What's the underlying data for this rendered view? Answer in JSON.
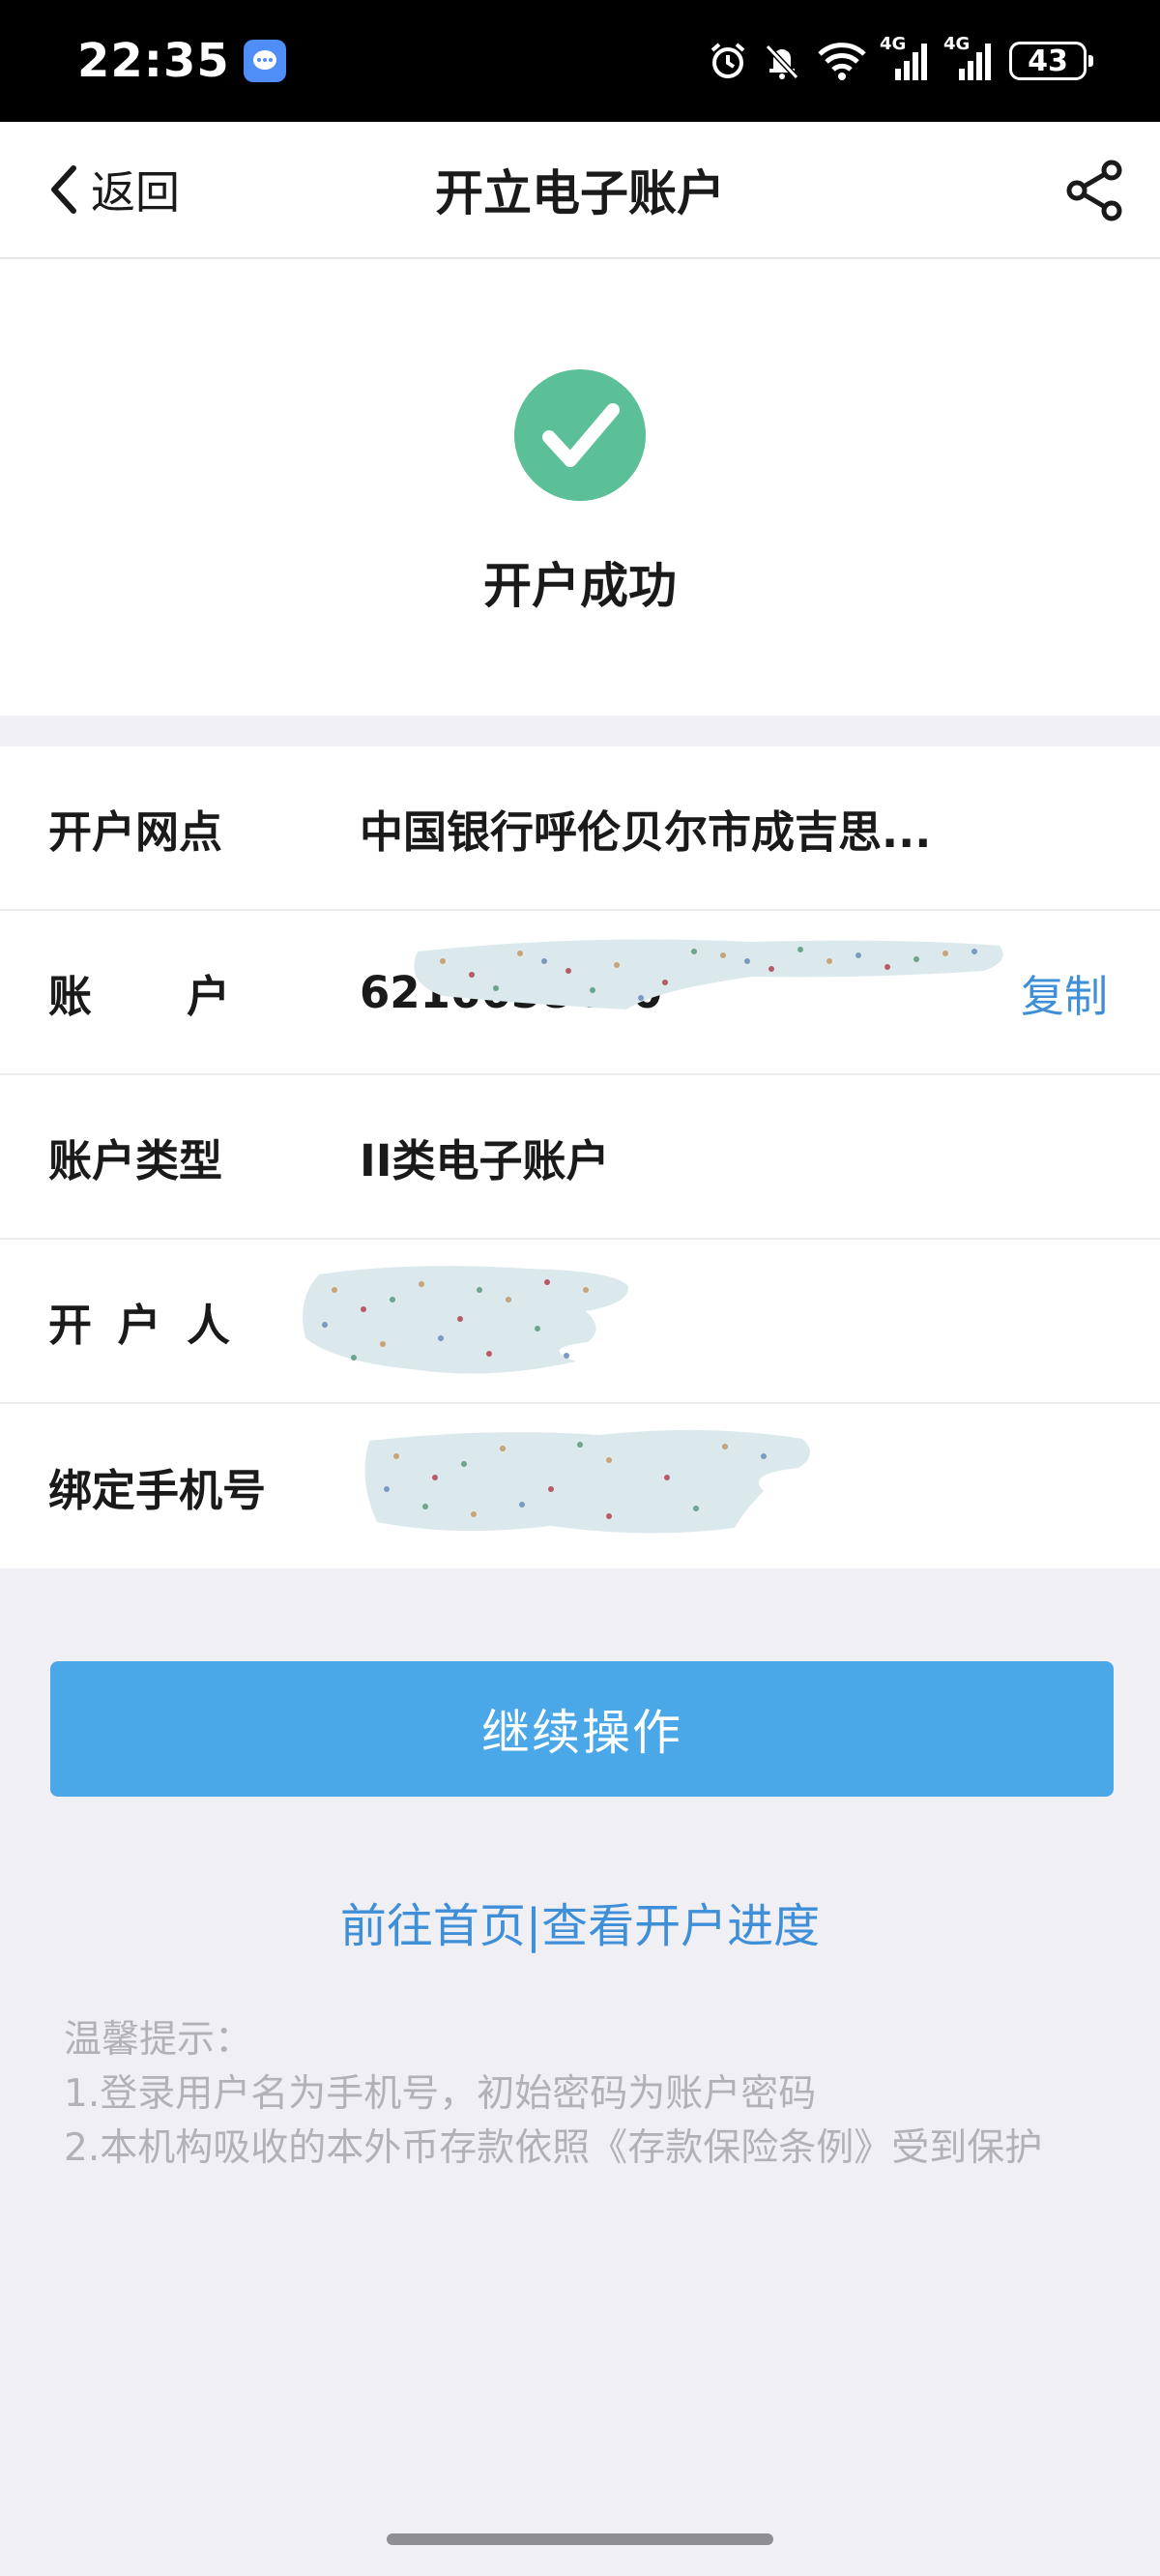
{
  "status_bar": {
    "time": "22:35",
    "network_1": "4G",
    "network_2": "4G",
    "battery": "43",
    "icons": [
      "message-app-icon",
      "alarm-icon",
      "bell-muted-icon",
      "wifi-icon",
      "signal-icon",
      "battery-icon"
    ]
  },
  "nav": {
    "back_label": "返回",
    "title": "开立电子账户",
    "share_icon": "share-icon"
  },
  "success": {
    "icon": "check-circle-icon",
    "text": "开户成功",
    "color": "#5bbf98"
  },
  "info": {
    "rows": [
      {
        "label": "开户网点",
        "value": "中国银行呼伦贝尔市成吉思..."
      },
      {
        "label": "账户",
        "value": "6216658400",
        "action": "复制"
      },
      {
        "label": "账户类型",
        "value": "II类电子账户"
      },
      {
        "label": "开户人",
        "value": ""
      },
      {
        "label": "绑定手机号",
        "value": ""
      }
    ]
  },
  "actions": {
    "continue_label": "继续操作",
    "home_link": "前往首页",
    "separator": "|",
    "progress_link": "查看开户进度"
  },
  "tips": {
    "title": "温馨提示：",
    "line1": "1.登录用户名为手机号，初始密码为账户密码",
    "line2": "2.本机构吸收的本外币存款依照《存款保险条例》受到保护"
  },
  "colors": {
    "accent": "#4aa7e8",
    "link": "#3f8fd8",
    "success": "#5bbf98",
    "background": "#efeff4"
  }
}
